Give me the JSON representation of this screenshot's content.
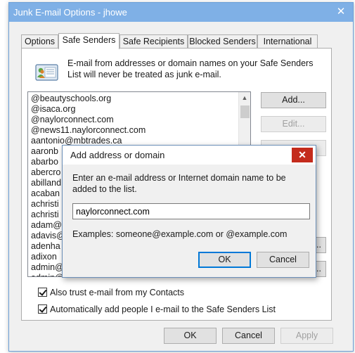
{
  "window": {
    "title": "Junk E-mail Options - jhowe",
    "close_glyph": "✕"
  },
  "tabs": [
    {
      "label": "Options",
      "active": false
    },
    {
      "label": "Safe Senders",
      "active": true
    },
    {
      "label": "Safe Recipients",
      "active": false
    },
    {
      "label": "Blocked Senders",
      "active": false
    },
    {
      "label": "International",
      "active": false
    }
  ],
  "info": {
    "icon": "address-book-icon",
    "text": "E-mail from addresses or domain names on your Safe Senders List will never be treated as junk e-mail."
  },
  "safe_senders": {
    "items": [
      "@beautyschools.org",
      "@isaca.org",
      "@naylorconnect.com",
      "@news11.naylorconnect.com",
      "aantonio@mbtrades.ca",
      "aaronb",
      "abarbo",
      "abercro",
      "abilland",
      "acaban",
      "achristi",
      "achristi",
      "adam@",
      "adavis@",
      "adenha",
      "adixon",
      "admin@",
      "admin@"
    ],
    "scroll_up_glyph": "▲"
  },
  "side_buttons": {
    "add": "Add...",
    "edit": "Edit...",
    "remove_tail": "e",
    "import_tail": "File...",
    "export_tail": "File..."
  },
  "options": {
    "trust_contacts": "Also trust e-mail from my Contacts",
    "auto_add": "Automatically add people I e-mail to the Safe Senders List"
  },
  "footer": {
    "ok": "OK",
    "cancel": "Cancel",
    "apply": "Apply"
  },
  "modal": {
    "title": "Add address or domain",
    "close_glyph": "✕",
    "prompt": "Enter an e-mail address or Internet domain name to be added to the list.",
    "value": "naylorconnect.com",
    "examples": "Examples: someone@example.com or @example.com",
    "ok": "OK",
    "cancel": "Cancel"
  },
  "colors": {
    "title_bar": "#7fb0e6",
    "modal_close": "#c42b1c",
    "default_button_border": "#0078d7"
  }
}
